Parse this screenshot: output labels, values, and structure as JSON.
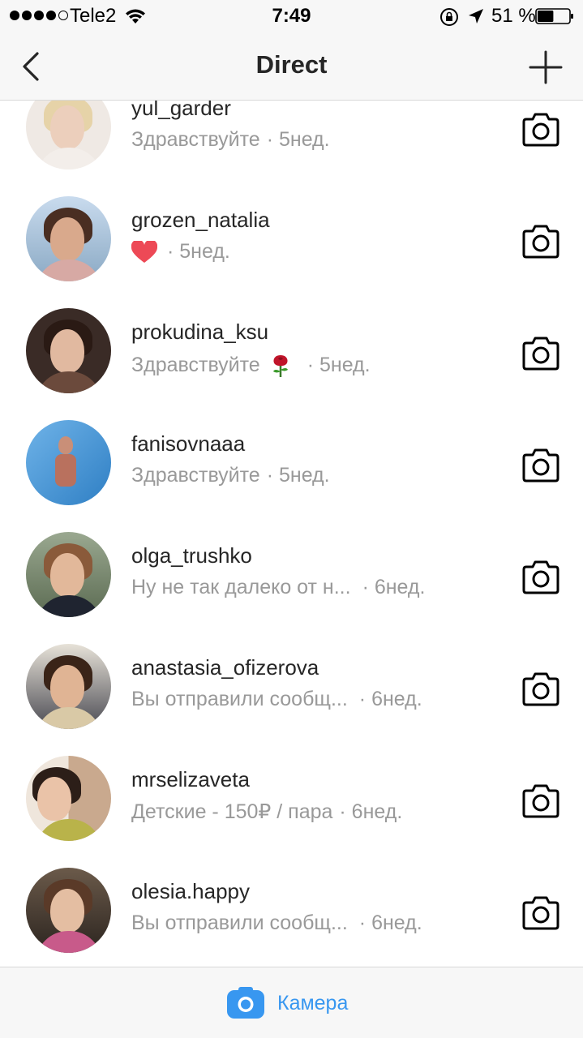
{
  "status_bar": {
    "carrier": "Tele2",
    "time": "7:49",
    "battery_percent": "51 %",
    "battery_level": 0.51,
    "signal_bars_filled": 4,
    "signal_bars_total": 5
  },
  "nav": {
    "title": "Direct",
    "back_icon": "chevron-left-icon",
    "new_icon": "plus-icon"
  },
  "threads": [
    {
      "username": "yul_garder",
      "message": "Здравствуйте",
      "time": "· 5нед."
    },
    {
      "username": "grozen_natalia",
      "message": "",
      "emoji": "heart",
      "time": "· 5нед."
    },
    {
      "username": "prokudina_ksu",
      "message": "Здравствуйте",
      "emoji": "rose",
      "time": "· 5нед."
    },
    {
      "username": "fanisovnaaa",
      "message": "Здравствуйте",
      "time": "· 5нед."
    },
    {
      "username": "olga_trushko",
      "message": "Ну не так далеко от н...",
      "time": "· 6нед."
    },
    {
      "username": "anastasia_ofizerova",
      "message": "Вы отправили сообщ...",
      "time": "· 6нед."
    },
    {
      "username": "mrselizaveta",
      "message": "Детские - 150₽ / пара",
      "time": "· 6нед."
    },
    {
      "username": "olesia.happy",
      "message": "Вы отправили сообщ...",
      "time": "· 6нед."
    }
  ],
  "bottom": {
    "camera_label": "Камера"
  },
  "colors": {
    "accent": "#3897f0",
    "heart": "#ed4956",
    "secondary_text": "#999999"
  }
}
